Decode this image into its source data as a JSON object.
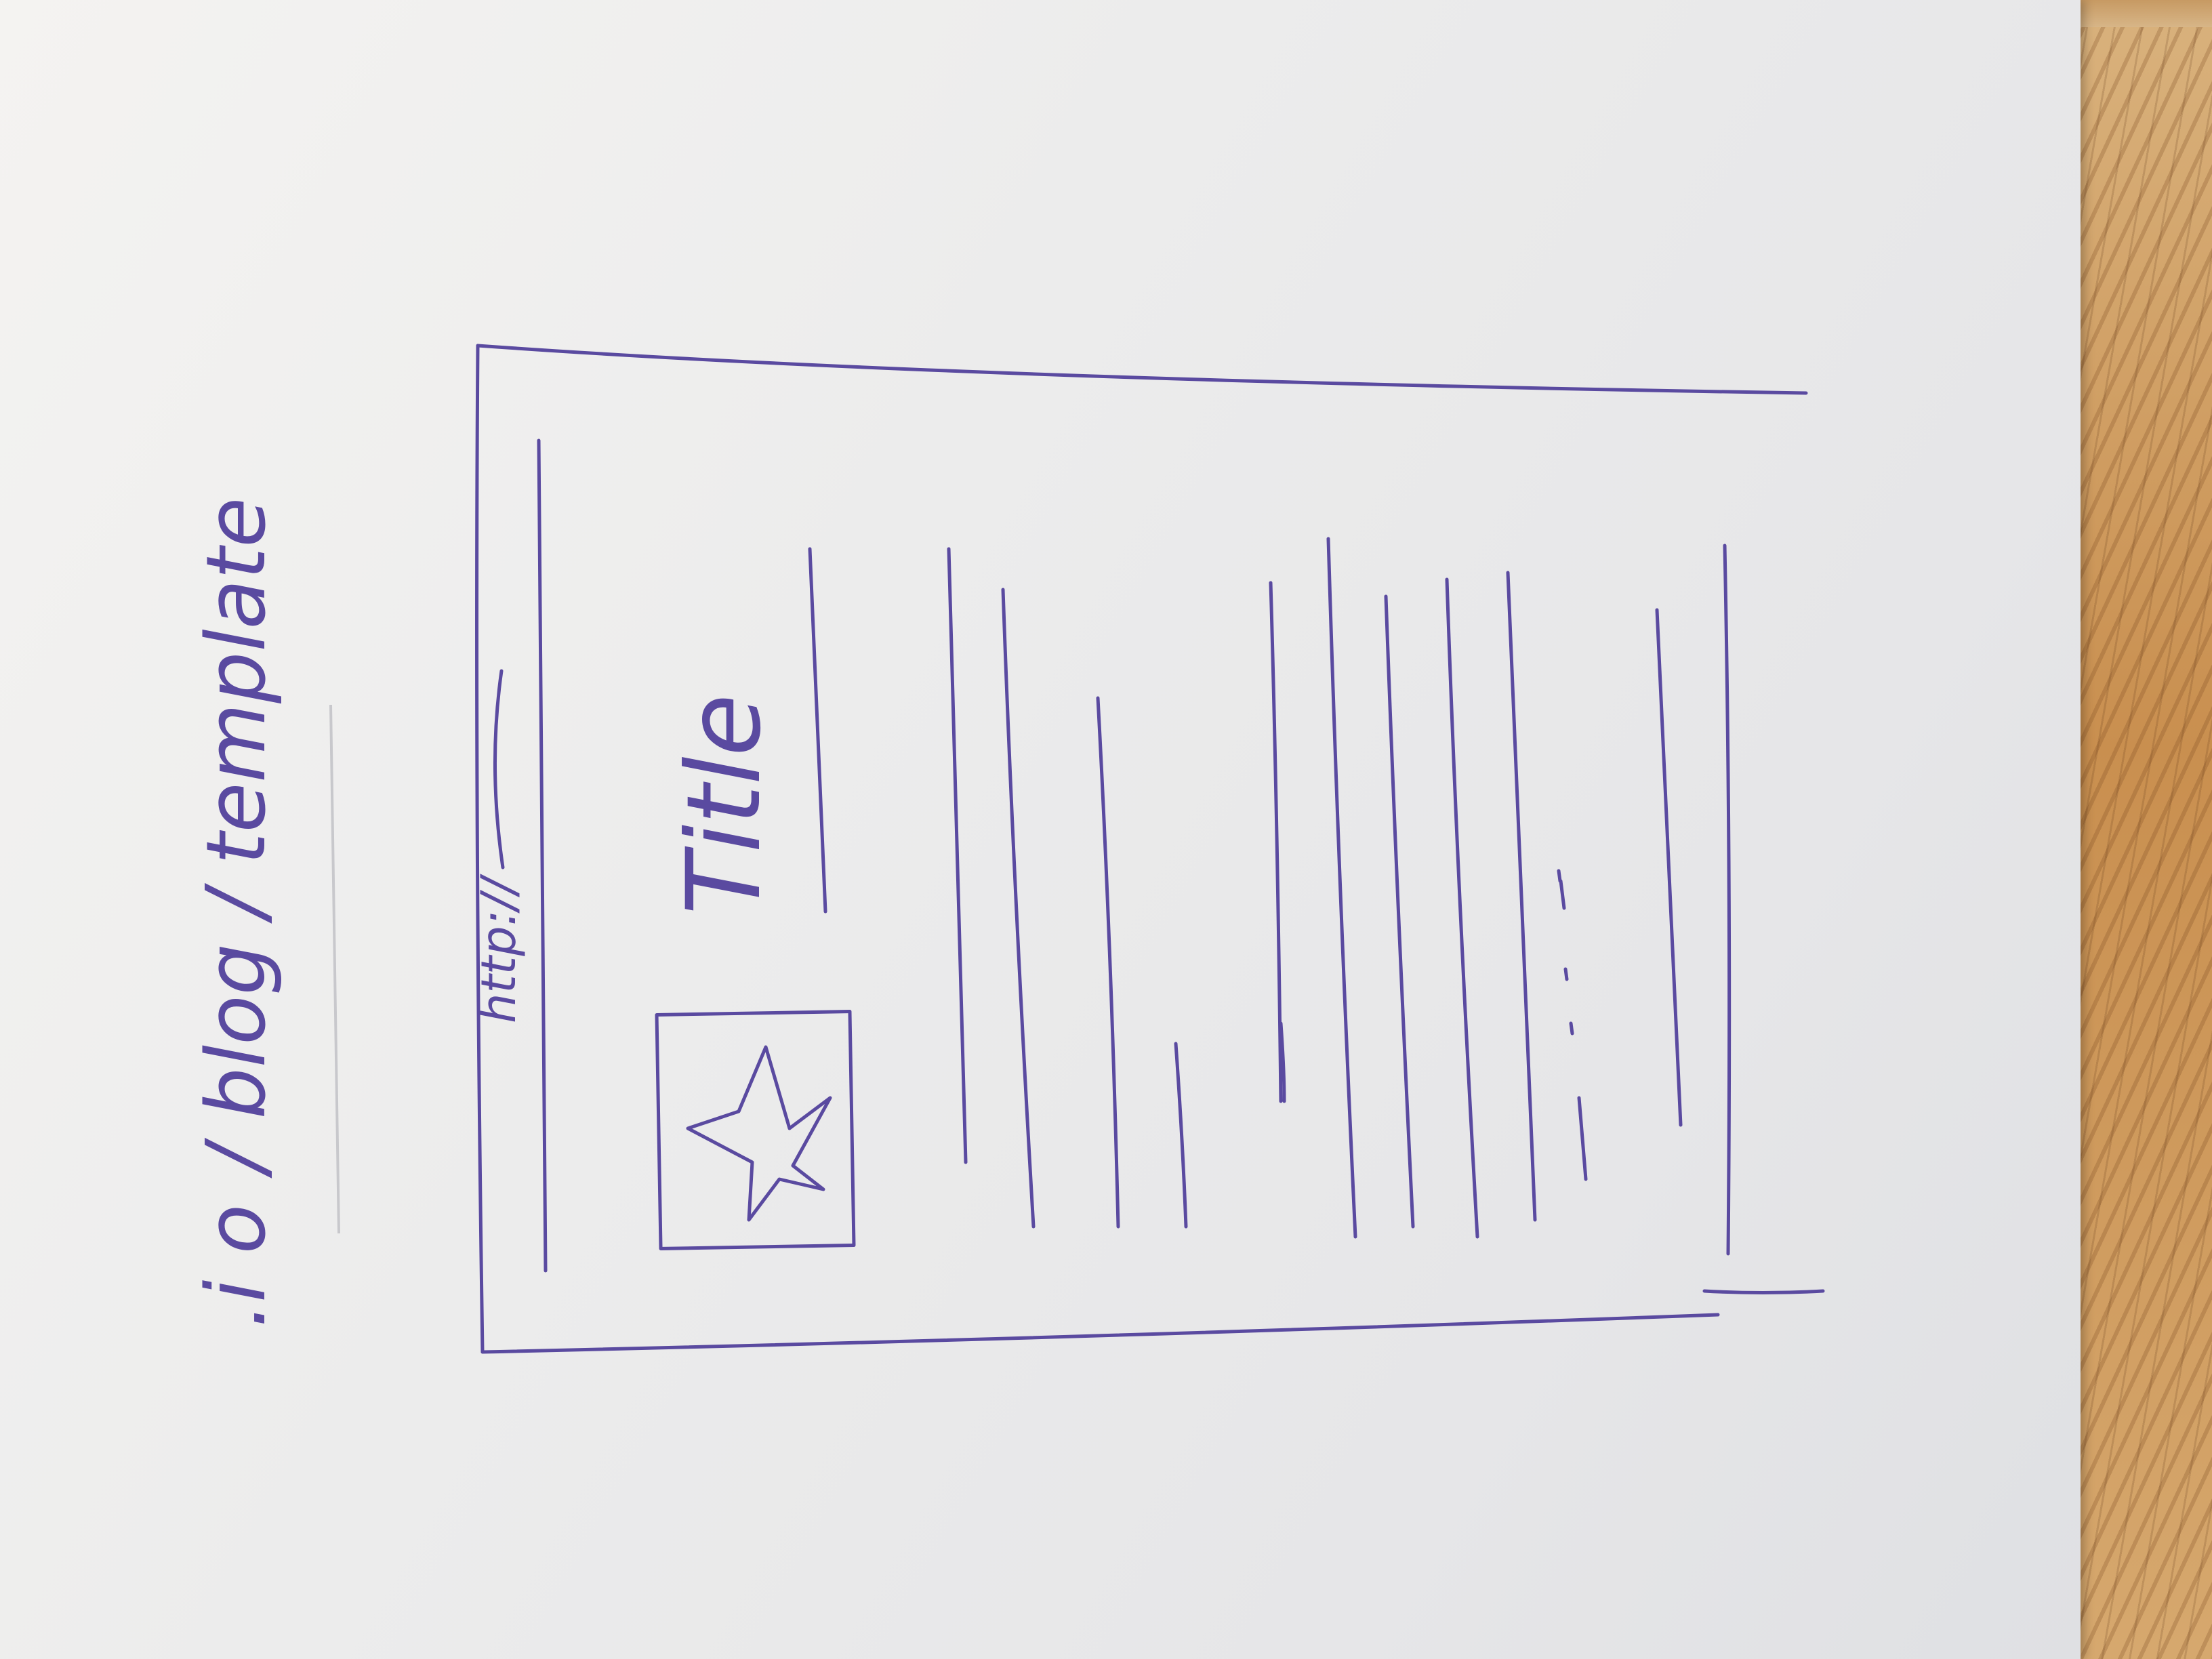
{
  "heading": {
    "text": "/ blog / template",
    "prefix_glyph": ".i o"
  },
  "mockup": {
    "url_text": "http://",
    "title_text": "Title",
    "image_icon": "star-icon"
  },
  "colors": {
    "ink": "#5a4aa0",
    "paper": "#ececec",
    "wood": "#c98f4f"
  }
}
